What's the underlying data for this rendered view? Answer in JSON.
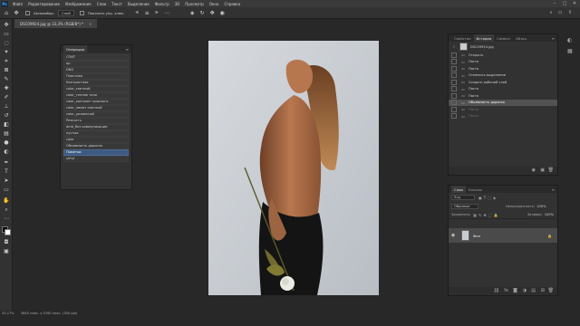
{
  "app": {
    "logo": "Ps"
  },
  "menu": [
    "Файл",
    "Редактирование",
    "Изображение",
    "Слои",
    "Текст",
    "Выделение",
    "Фильтр",
    "3D",
    "Просмотр",
    "Окно",
    "Справка"
  ],
  "window_controls": [
    "–",
    "□",
    "✕"
  ],
  "options": {
    "mode_label": "Автовыбор:",
    "mode_value": "Слой",
    "show_transform": "Показать упр. элем."
  },
  "document_tab": {
    "title": "DSC09924.jpg @ 33,3% (RGB/8*) *",
    "close": "×"
  },
  "actions_panel": {
    "title": "Операции",
    "items": [
      "СПИТ",
      "ор",
      "DNG",
      "Пластика",
      "Контрастная",
      "color_светлый",
      "color_теплое тело",
      "color_контраст красного",
      "color_лимит светлый",
      "color_розоватый",
      "Резкость",
      "dmb_без коммуникации",
      "пустые",
      "color",
      "Объемность дорогая",
      "Пометки",
      "ulfruf"
    ],
    "selected_index": 15
  },
  "history_panel": {
    "tabs": [
      "Свойства",
      "История",
      "Символ",
      "Абзац"
    ],
    "active_tab": 1,
    "snapshot": "DSC09924.jpg",
    "items": [
      "Открыть",
      "Пасто",
      "Пасто",
      "Отменить выделение",
      "Создать рабочий слой",
      "Пасто",
      "Пасто",
      "Объемность дорогая",
      "Пасто",
      "Пасто"
    ],
    "selected_index": 7,
    "dim_from": 8
  },
  "layers_panel": {
    "tabs": [
      "Слои",
      "Каналы"
    ],
    "active_tab": 0,
    "search_placeholder": "Вид",
    "blend_mode": "Обычные",
    "opacity_label": "Непрозрачность:",
    "opacity_value": "100%",
    "lock_label": "Закрепить:",
    "fill_label": "Заливка:",
    "fill_value": "100%",
    "layers": [
      {
        "name": "Фон",
        "visible": true,
        "locked": true
      }
    ]
  },
  "status": {
    "zoom": "33,17%",
    "info": "3840 пикс. x 5760 пикс. (300 ppi)"
  },
  "colors": {
    "canvas_bg": "#c9cdd2",
    "selection": "#3d5a80",
    "panel": "#323232",
    "workspace": "#282828"
  },
  "icons": {
    "toolbar": [
      "move-tool-icon",
      "artboard-icon",
      "lasso-icon",
      "magic-wand-icon",
      "crop-icon",
      "frame-icon",
      "eyedropper-icon",
      "healing-brush-icon",
      "brush-icon",
      "clone-stamp-icon",
      "history-brush-icon",
      "eraser-icon",
      "gradient-icon",
      "blur-icon",
      "dodge-icon",
      "pen-icon",
      "type-icon",
      "path-select-icon",
      "rectangle-icon",
      "hand-icon",
      "zoom-icon",
      "more-tools-icon"
    ]
  }
}
